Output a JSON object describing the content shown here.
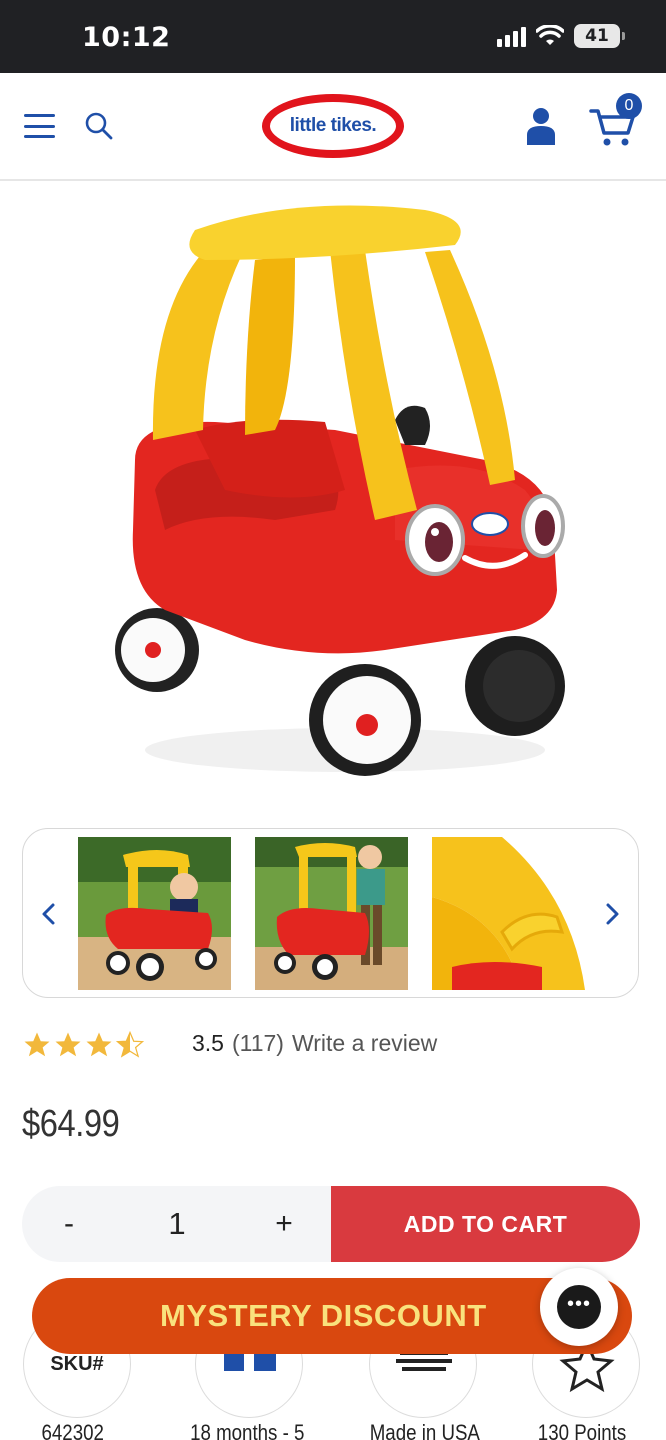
{
  "status_bar": {
    "time": "10:12",
    "battery": "41",
    "icons": [
      "signal-icon",
      "wifi-icon",
      "battery-icon"
    ]
  },
  "header": {
    "logo_text": "little tikes.",
    "cart_count": "0",
    "brand_colors": {
      "blue": "#1f4fa8",
      "red": "#e1141c"
    },
    "icons": [
      "menu-icon",
      "search-icon",
      "account-icon",
      "cart-icon"
    ]
  },
  "product": {
    "image_alt": "Cozy Coupe",
    "rating": {
      "stars": 3.5,
      "value": "3.5",
      "count": "(117)",
      "write_review": "Write a review"
    },
    "price": "$64.99",
    "quantity": "1",
    "minus_label": "-",
    "plus_label": "+",
    "add_to_cart": "ADD TO CART"
  },
  "carousel": {
    "prev_icon": "chevron-left-icon",
    "next_icon": "chevron-right-icon",
    "thumbnail_count": 3
  },
  "features": [
    {
      "badge": "SKU#",
      "label": "642302"
    },
    {
      "badge": "",
      "label": "18 months - 5"
    },
    {
      "badge": "",
      "label": "Made in USA"
    },
    {
      "badge": "",
      "label": "130 Points"
    }
  ],
  "promo": {
    "banner_text": "MYSTERY DISCOUNT",
    "chat_icon": "chat-bubble-icon"
  },
  "colors": {
    "add_to_cart_bg": "#d93a3f",
    "banner_bg": "#d9480f",
    "banner_text": "#f9e27d",
    "star": "#f2b83b"
  }
}
